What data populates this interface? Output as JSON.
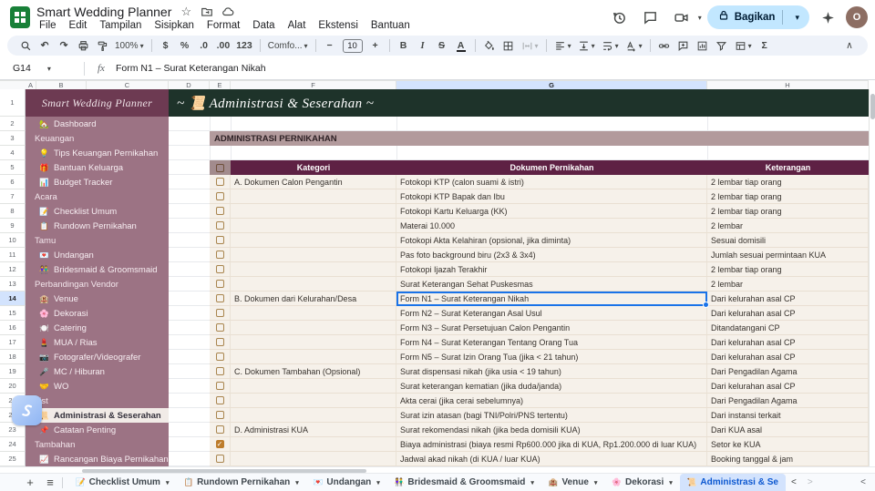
{
  "topbar": {
    "title": "Smart Wedding Planner",
    "title_icons": [
      "star-icon",
      "move-folder-icon",
      "cloud-status-icon"
    ],
    "menu_items": [
      "File",
      "Edit",
      "Tampilan",
      "Sisipkan",
      "Format",
      "Data",
      "Alat",
      "Ekstensi",
      "Bantuan"
    ],
    "right_icons": [
      "version-history-icon",
      "comments-icon",
      "video-call-icon"
    ],
    "share_label": "Bagikan",
    "avatar_letter": "O"
  },
  "toolbar": {
    "zoom_value": "100%",
    "font_name": "Comfo...",
    "font_size": "10",
    "items": [
      {
        "name": "search",
        "type": "svg"
      },
      {
        "name": "undo",
        "type": "glyph",
        "glyph": "↶"
      },
      {
        "name": "redo",
        "type": "glyph",
        "glyph": "↷"
      },
      {
        "name": "print",
        "type": "svg"
      },
      {
        "name": "paint-format",
        "type": "svg"
      },
      {
        "name": "zoom-select",
        "type": "label",
        "bind": "zoom_value",
        "caret": true
      },
      {
        "type": "sep"
      },
      {
        "name": "format-currency",
        "type": "glyph",
        "glyph": "$"
      },
      {
        "name": "format-percent",
        "type": "glyph",
        "glyph": "%"
      },
      {
        "name": "decrease-decimals",
        "type": "glyph",
        "glyph": ".0"
      },
      {
        "name": "increase-decimals",
        "type": "glyph",
        "glyph": ".00"
      },
      {
        "name": "more-formats",
        "type": "glyph",
        "glyph": "123"
      },
      {
        "type": "sep"
      },
      {
        "name": "font-select",
        "type": "label",
        "bind": "font_name",
        "caret": true
      },
      {
        "type": "sep"
      },
      {
        "name": "decrease-font-size",
        "type": "glyph",
        "glyph": "−"
      },
      {
        "name": "font-size-box",
        "type": "box",
        "bind": "font_size"
      },
      {
        "name": "increase-font-size",
        "type": "glyph",
        "glyph": "+"
      },
      {
        "type": "sep"
      },
      {
        "name": "bold",
        "type": "glyph",
        "glyph": "B",
        "style": "font-weight:700"
      },
      {
        "name": "italic",
        "type": "glyph",
        "glyph": "I",
        "style": "font-style:italic;font-family:'Liberation Serif',serif"
      },
      {
        "name": "strikethrough",
        "type": "glyph",
        "glyph": "S",
        "style": "text-decoration:line-through"
      },
      {
        "name": "text-color",
        "type": "glyph",
        "glyph": "A",
        "underbar": true
      },
      {
        "type": "sep"
      },
      {
        "name": "fill-color",
        "type": "svg"
      },
      {
        "name": "borders",
        "type": "svg"
      },
      {
        "name": "merge-cells",
        "type": "svg",
        "caret": true,
        "disabled": true
      },
      {
        "type": "sep"
      },
      {
        "name": "horizontal-align",
        "type": "svg",
        "caret": true
      },
      {
        "name": "vertical-align",
        "type": "svg",
        "caret": true
      },
      {
        "name": "text-wrap",
        "type": "svg",
        "caret": true
      },
      {
        "name": "text-rotate",
        "type": "svg",
        "caret": true
      },
      {
        "type": "sep"
      },
      {
        "name": "insert-link",
        "type": "svg"
      },
      {
        "name": "insert-comment",
        "type": "svg"
      },
      {
        "name": "insert-chart",
        "type": "svg"
      },
      {
        "name": "filter",
        "type": "svg"
      },
      {
        "name": "sheet-views",
        "type": "svg",
        "caret": true
      },
      {
        "name": "functions",
        "type": "glyph",
        "glyph": "Σ"
      }
    ],
    "collapse_glyph": "∧"
  },
  "formula_bar": {
    "cell_ref": "G14",
    "value": "Form N1 – Surat Keterangan Nikah"
  },
  "grid": {
    "columns": [
      "A",
      "B",
      "C",
      "D",
      "E",
      "F",
      "G",
      "H"
    ],
    "selected_column": "G",
    "selected_row": 14,
    "row_count": 25
  },
  "sidebar": {
    "title": "Smart Wedding Planner",
    "items": [
      {
        "row": 2,
        "type": "item",
        "icon": "🏡",
        "label": "Dashboard"
      },
      {
        "row": 3,
        "type": "section",
        "label": "Keuangan"
      },
      {
        "row": 4,
        "type": "item",
        "icon": "💡",
        "label": "Tips Keuangan Pernikahan"
      },
      {
        "row": 5,
        "type": "item",
        "icon": "🎁",
        "label": "Bantuan Keluarga"
      },
      {
        "row": 6,
        "type": "item",
        "icon": "📊",
        "label": "Budget Tracker"
      },
      {
        "row": 7,
        "type": "section",
        "label": "Acara"
      },
      {
        "row": 8,
        "type": "item",
        "icon": "📝",
        "label": "Checklist Umum"
      },
      {
        "row": 9,
        "type": "item",
        "icon": "📋",
        "label": "Rundown Pernikahan"
      },
      {
        "row": 10,
        "type": "section",
        "label": "Tamu"
      },
      {
        "row": 11,
        "type": "item",
        "icon": "💌",
        "label": "Undangan"
      },
      {
        "row": 12,
        "type": "item",
        "icon": "👫",
        "label": "Bridesmaid & Groomsmaid"
      },
      {
        "row": 13,
        "type": "section",
        "label": "Perbandingan Vendor"
      },
      {
        "row": 14,
        "type": "item",
        "icon": "🏨",
        "label": "Venue"
      },
      {
        "row": 15,
        "type": "item",
        "icon": "🌸",
        "label": "Dekorasi"
      },
      {
        "row": 16,
        "type": "item",
        "icon": "🍽️",
        "label": "Catering"
      },
      {
        "row": 17,
        "type": "item",
        "icon": "💄",
        "label": "MUA / Rias"
      },
      {
        "row": 18,
        "type": "item",
        "icon": "📷",
        "label": "Fotografer/Videografer"
      },
      {
        "row": 19,
        "type": "item",
        "icon": "🎤",
        "label": "MC / Hiburan"
      },
      {
        "row": 20,
        "type": "item",
        "icon": "🤝",
        "label": "WO"
      },
      {
        "row": 21,
        "type": "section",
        "label": "List"
      },
      {
        "row": 22,
        "type": "item",
        "icon": "📜",
        "label": "Administrasi & Seserahan",
        "active": true
      },
      {
        "row": 23,
        "type": "item",
        "icon": "📌",
        "label": "Catatan Penting"
      },
      {
        "row": 24,
        "type": "section",
        "label": "Tambahan"
      },
      {
        "row": 25,
        "type": "item",
        "icon": "📈",
        "label": "Rancangan Biaya Pernikahan"
      }
    ]
  },
  "sheet": {
    "page_title": "~ 📜 Administrasi & Seserahan ~",
    "section_banner": "ADMINISTRASI PERNIKAHAN",
    "table_headers": [
      "Kategori",
      "Dokumen Pernikahan",
      "Keterangan"
    ],
    "rows": [
      {
        "row": 6,
        "checked": false,
        "kategori": "A. Dokumen Calon Pengantin",
        "dokumen": "Fotokopi KTP (calon suami & istri)",
        "keterangan": "2 lembar tiap orang"
      },
      {
        "row": 7,
        "checked": false,
        "kategori": "",
        "dokumen": "Fotokopi KTP Bapak dan Ibu",
        "keterangan": "2 lembar tiap orang"
      },
      {
        "row": 8,
        "checked": false,
        "kategori": "",
        "dokumen": "Fotokopi Kartu Keluarga (KK)",
        "keterangan": "2 lembar tiap orang"
      },
      {
        "row": 9,
        "checked": false,
        "kategori": "",
        "dokumen": "Materai 10.000",
        "keterangan": "2 lembar"
      },
      {
        "row": 10,
        "checked": false,
        "kategori": "",
        "dokumen": "Fotokopi Akta Kelahiran (opsional, jika diminta)",
        "keterangan": "Sesuai domisili"
      },
      {
        "row": 11,
        "checked": false,
        "kategori": "",
        "dokumen": "Pas foto background biru (2x3 & 3x4)",
        "keterangan": "Jumlah sesuai permintaan KUA"
      },
      {
        "row": 12,
        "checked": false,
        "kategori": "",
        "dokumen": "Fotokopi Ijazah Terakhir",
        "keterangan": "2 lembar tiap orang"
      },
      {
        "row": 13,
        "checked": false,
        "kategori": "",
        "dokumen": "Surat Keterangan Sehat Puskesmas",
        "keterangan": "2 lembar"
      },
      {
        "row": 14,
        "checked": false,
        "kategori": "B. Dokumen dari Kelurahan/Desa",
        "dokumen": "Form N1 – Surat Keterangan Nikah",
        "keterangan": "Dari kelurahan asal CP",
        "selected": true
      },
      {
        "row": 15,
        "checked": false,
        "kategori": "",
        "dokumen": "Form N2 – Surat Keterangan Asal Usul",
        "keterangan": "Dari kelurahan asal CP"
      },
      {
        "row": 16,
        "checked": false,
        "kategori": "",
        "dokumen": "Form N3 – Surat Persetujuan Calon Pengantin",
        "keterangan": "Ditandatangani CP"
      },
      {
        "row": 17,
        "checked": false,
        "kategori": "",
        "dokumen": "Form N4 – Surat Keterangan Tentang Orang Tua",
        "keterangan": "Dari kelurahan asal CP"
      },
      {
        "row": 18,
        "checked": false,
        "kategori": "",
        "dokumen": "Form N5 – Surat Izin Orang Tua (jika < 21 tahun)",
        "keterangan": "Dari kelurahan asal CP"
      },
      {
        "row": 19,
        "checked": false,
        "kategori": "C. Dokumen Tambahan (Opsional)",
        "dokumen": "Surat dispensasi nikah (jika usia < 19 tahun)",
        "keterangan": "Dari Pengadilan Agama"
      },
      {
        "row": 20,
        "checked": false,
        "kategori": "",
        "dokumen": "Surat keterangan kematian (jika duda/janda)",
        "keterangan": "Dari kelurahan asal CP"
      },
      {
        "row": 21,
        "checked": false,
        "kategori": "",
        "dokumen": "Akta cerai (jika cerai sebelumnya)",
        "keterangan": "Dari Pengadilan Agama"
      },
      {
        "row": 22,
        "checked": false,
        "kategori": "",
        "dokumen": "Surat izin atasan (bagi TNI/Polri/PNS tertentu)",
        "keterangan": "Dari instansi terkait"
      },
      {
        "row": 23,
        "checked": false,
        "kategori": "D. Administrasi KUA",
        "dokumen": "Surat rekomendasi nikah (jika beda domisili KUA)",
        "keterangan": "Dari KUA asal"
      },
      {
        "row": 24,
        "checked": true,
        "kategori": "",
        "dokumen": "Biaya administrasi (biaya resmi Rp600.000 jika di KUA, Rp1.200.000 di luar KUA)",
        "keterangan": "Setor ke KUA"
      },
      {
        "row": 25,
        "checked": false,
        "kategori": "",
        "dokumen": "Jadwal akad nikah (di KUA / luar KUA)",
        "keterangan": "Booking tanggal & jam"
      }
    ]
  },
  "tabbar": {
    "tabs": [
      {
        "icon": "📝",
        "label": "Checklist Umum"
      },
      {
        "icon": "📋",
        "label": "Rundown Pernikahan"
      },
      {
        "icon": "💌",
        "label": "Undangan"
      },
      {
        "icon": "👫",
        "label": "Bridesmaid & Groomsmaid"
      },
      {
        "icon": "🏨",
        "label": "Venue"
      },
      {
        "icon": "🌸",
        "label": "Dekorasi"
      },
      {
        "icon": "📜",
        "label": "Administrasi & Se",
        "active": true
      }
    ]
  },
  "colors": {
    "accent_blue": "#1a73e8",
    "sidebar_plum": "#9c7384",
    "sidebar_title_plum": "#6d3a52",
    "banner_green": "#1e332a",
    "banner_mauve": "#b29a9c",
    "header_maroon": "#5e2144",
    "row_cream": "#f6f1ea",
    "checkbox_checked": "#bd7c2c",
    "share_pill_blue": "#c2e7ff"
  }
}
